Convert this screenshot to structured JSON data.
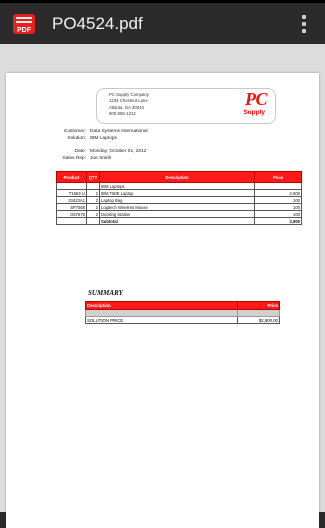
{
  "app": {
    "title": "PO4524.pdf",
    "icon": "pdf-app-icon",
    "icon_text": "PDF",
    "menu_icon": "overflow-menu-icon"
  },
  "doc": {
    "company": {
      "address_lines": [
        "PC Supply Company",
        "1234 Chestnut Lane",
        "Atlanta, GA 30043",
        "800-555-1212"
      ],
      "logo_text": "PC",
      "logo_sub": "Supply"
    },
    "meta": [
      {
        "label": "Customer:",
        "value": "Data Systems International"
      },
      {
        "label": "Solution:",
        "value": "IBM Laptops"
      },
      {
        "label": "Date:",
        "value": "Monday, October 01, 2012"
      },
      {
        "label": "Sales Rep:",
        "value": "Joe Smith"
      }
    ],
    "items_table": {
      "headers": [
        "Product",
        "QTY",
        "Description",
        "Price"
      ],
      "rows": [
        [
          "",
          "",
          "IBM Laptops",
          ""
        ],
        [
          "T1563-U",
          "2",
          "IBM T60E Laptop",
          "2,600"
        ],
        [
          "23423A1",
          "2",
          "Laptop Bag",
          "100"
        ],
        [
          "SP7568",
          "2",
          "Logitech Wireless Mouse",
          "100"
        ],
        [
          "G67678",
          "2",
          "Docking Station",
          "100"
        ]
      ],
      "subtotal_label": "Subtotal",
      "subtotal_value": "2,900"
    },
    "summary": {
      "title": "SUMMARY",
      "headers": [
        "Description",
        "Price"
      ],
      "row_label": "SOLUTION PRICE",
      "row_value": "$2,900.00"
    }
  },
  "colors": {
    "accent": "#ff1a1a",
    "action_bar": "#2b2b2b",
    "viewer_bg": "#dcdcdc"
  }
}
